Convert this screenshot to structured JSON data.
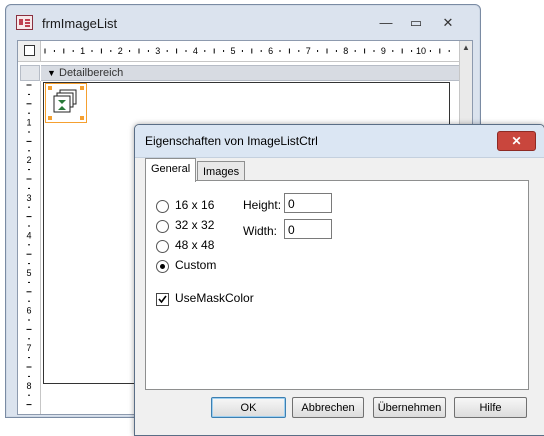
{
  "background_window": {
    "title": "frmImageList",
    "section_label": "Detailbereich",
    "ruler_numbers": [
      "1",
      "2",
      "3",
      "4",
      "5",
      "6",
      "7",
      "8",
      "9",
      "10",
      "1"
    ],
    "vruler_numbers": [
      "1",
      "2",
      "3",
      "4",
      "5",
      "6",
      "7",
      "8"
    ],
    "controls": {
      "minimize": "—",
      "restore": "▭",
      "close": "✕"
    }
  },
  "dialog": {
    "title": "Eigenschaften von ImageListCtrl",
    "close_label": "✕",
    "tabs": [
      {
        "label": "General",
        "active": true
      },
      {
        "label": "Images",
        "active": false
      }
    ],
    "size_options": [
      {
        "label": "16 x 16",
        "selected": false
      },
      {
        "label": "32 x 32",
        "selected": false
      },
      {
        "label": "48 x 48",
        "selected": false
      },
      {
        "label": "Custom",
        "selected": true
      }
    ],
    "height_label": "Height:",
    "height_value": "0",
    "width_label": "Width:",
    "width_value": "0",
    "mask_label": "UseMaskColor",
    "mask_checked": true,
    "buttons": {
      "ok": "OK",
      "cancel": "Abbrechen",
      "apply": "Übernehmen",
      "help": "Hilfe"
    }
  }
}
